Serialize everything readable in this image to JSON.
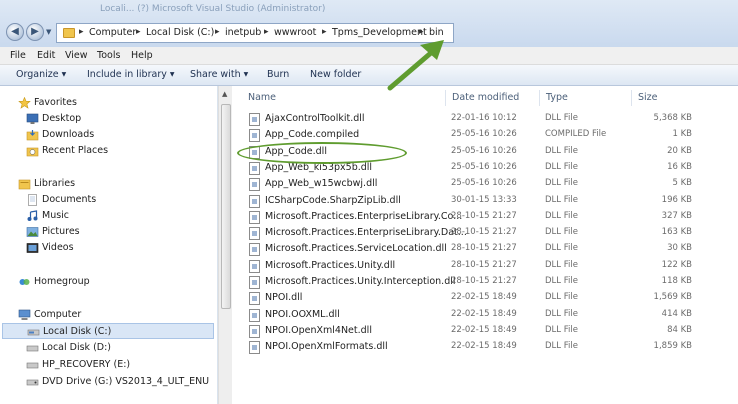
{
  "window": {
    "title": "Locali... (?) Microsoft Visual Studio (Administrator)"
  },
  "address": {
    "crumbs": [
      "Computer",
      "Local Disk (C:)",
      "inetpub",
      "wwwroot",
      "Tpms_Development",
      "bin"
    ]
  },
  "menu": [
    "File",
    "Edit",
    "View",
    "Tools",
    "Help"
  ],
  "toolbar": {
    "organize": "Organize",
    "include_in_library": "Include in library",
    "share_with": "Share with",
    "burn": "Burn",
    "new_folder": "New folder"
  },
  "nav": {
    "favorites": "Favorites",
    "desktop": "Desktop",
    "downloads": "Downloads",
    "recent_places": "Recent Places",
    "libraries": "Libraries",
    "documents": "Documents",
    "music": "Music",
    "pictures": "Pictures",
    "videos": "Videos",
    "homegroup": "Homegroup",
    "computer": "Computer",
    "local_c": "Local Disk (C:)",
    "local_d": "Local Disk (D:)",
    "hp_recovery": "HP_RECOVERY (E:)",
    "dvd": "DVD Drive (G:) VS2013_4_ULT_ENU"
  },
  "columns": {
    "name": "Name",
    "date": "Date modified",
    "type": "Type",
    "size": "Size"
  },
  "files": [
    {
      "name": "AjaxControlToolkit.dll",
      "date": "22-01-16 10:12",
      "type": "DLL File",
      "size": "5,368 KB"
    },
    {
      "name": "App_Code.compiled",
      "date": "25-05-16 10:26",
      "type": "COMPILED File",
      "size": "1 KB"
    },
    {
      "name": "App_Code.dll",
      "date": "25-05-16 10:26",
      "type": "DLL File",
      "size": "20 KB"
    },
    {
      "name": "App_Web_ki53px5b.dll",
      "date": "25-05-16 10:26",
      "type": "DLL File",
      "size": "16 KB"
    },
    {
      "name": "App_Web_w15wcbwj.dll",
      "date": "25-05-16 10:26",
      "type": "DLL File",
      "size": "5 KB"
    },
    {
      "name": "ICSharpCode.SharpZipLib.dll",
      "date": "30-01-15 13:33",
      "type": "DLL File",
      "size": "196 KB"
    },
    {
      "name": "Microsoft.Practices.EnterpriseLibrary.Co...",
      "date": "28-10-15 21:27",
      "type": "DLL File",
      "size": "327 KB"
    },
    {
      "name": "Microsoft.Practices.EnterpriseLibrary.Dat...",
      "date": "28-10-15 21:27",
      "type": "DLL File",
      "size": "163 KB"
    },
    {
      "name": "Microsoft.Practices.ServiceLocation.dll",
      "date": "28-10-15 21:27",
      "type": "DLL File",
      "size": "30 KB"
    },
    {
      "name": "Microsoft.Practices.Unity.dll",
      "date": "28-10-15 21:27",
      "type": "DLL File",
      "size": "122 KB"
    },
    {
      "name": "Microsoft.Practices.Unity.Interception.dll",
      "date": "28-10-15 21:27",
      "type": "DLL File",
      "size": "118 KB"
    },
    {
      "name": "NPOI.dll",
      "date": "22-02-15 18:49",
      "type": "DLL File",
      "size": "1,569 KB"
    },
    {
      "name": "NPOI.OOXML.dll",
      "date": "22-02-15 18:49",
      "type": "DLL File",
      "size": "414 KB"
    },
    {
      "name": "NPOI.OpenXml4Net.dll",
      "date": "22-02-15 18:49",
      "type": "DLL File",
      "size": "84 KB"
    },
    {
      "name": "NPOI.OpenXmlFormats.dll",
      "date": "22-02-15 18:49",
      "type": "DLL File",
      "size": "1,859 KB"
    }
  ],
  "annotation": {
    "color": "#5f9c2f"
  }
}
